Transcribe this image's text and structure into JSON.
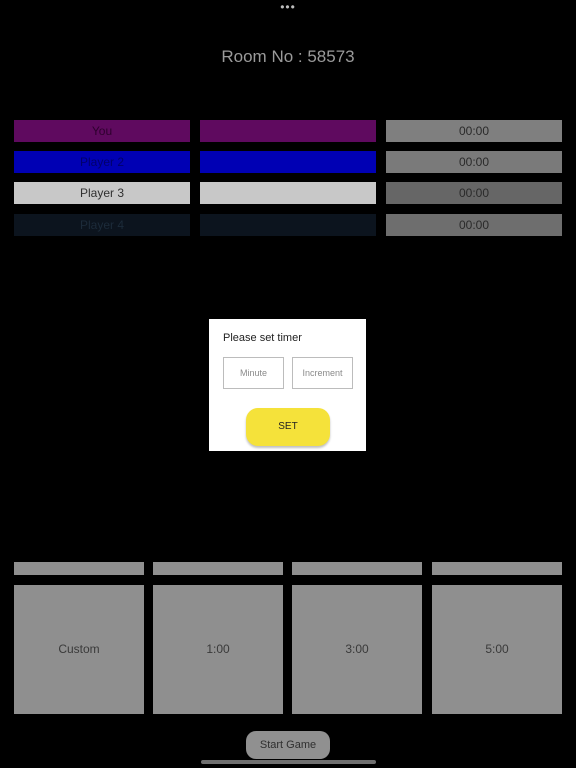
{
  "status_bar": {
    "dots": "•••"
  },
  "room": {
    "title": "Room No : 58573"
  },
  "players": [
    {
      "name": "You",
      "time": "00:00",
      "color": "#5f0a5f",
      "text_color": "#2e002e"
    },
    {
      "name": "Player 2",
      "time": "00:00",
      "color": "#0000b4",
      "text_color": "#00006a"
    },
    {
      "name": "Player 3",
      "time": "00:00",
      "color": "#c8c8c8",
      "text_color": "#303030"
    },
    {
      "name": "Player 4",
      "time": "00:00",
      "color": "#0c141e",
      "text_color": "#1c2b3a"
    }
  ],
  "presets": [
    {
      "label": "Custom"
    },
    {
      "label": "1:00"
    },
    {
      "label": "3:00"
    },
    {
      "label": "5:00"
    }
  ],
  "actions": {
    "start_game": "Start Game"
  },
  "dialog": {
    "title": "Please set timer",
    "minute_placeholder": "Minute",
    "increment_placeholder": "Increment",
    "set_label": "SET"
  }
}
